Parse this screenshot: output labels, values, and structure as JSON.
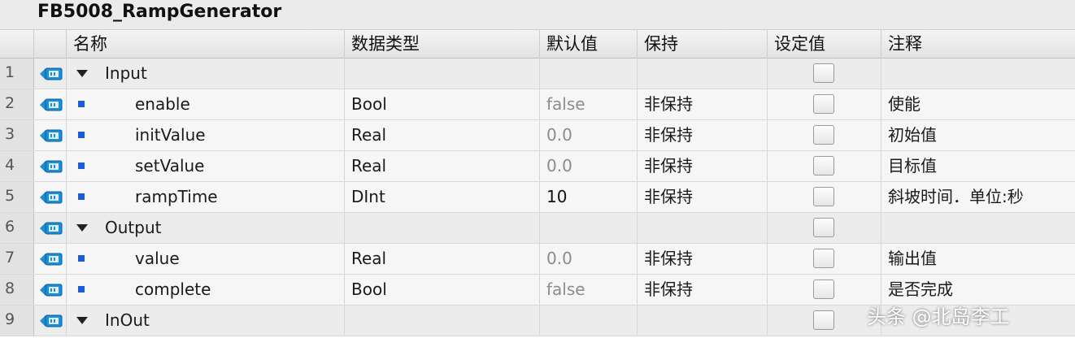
{
  "block_title": "FB5008_RampGenerator",
  "columns": {
    "name": "名称",
    "data_type": "数据类型",
    "default_value": "默认值",
    "retain": "保持",
    "setpoint": "设定值",
    "comment": "注释"
  },
  "rows": [
    {
      "num": "1",
      "kind": "section",
      "name": "Input",
      "type": "",
      "default": "",
      "retain": "",
      "setpoint": false,
      "comment": ""
    },
    {
      "num": "2",
      "kind": "member",
      "name": "enable",
      "type": "Bool",
      "default": "false",
      "retain": "非保持",
      "setpoint": false,
      "comment": "使能"
    },
    {
      "num": "3",
      "kind": "member",
      "name": "initValue",
      "type": "Real",
      "default": "0.0",
      "retain": "非保持",
      "setpoint": false,
      "comment": "初始值"
    },
    {
      "num": "4",
      "kind": "member",
      "name": "setValue",
      "type": "Real",
      "default": "0.0",
      "retain": "非保持",
      "setpoint": false,
      "comment": "目标值"
    },
    {
      "num": "5",
      "kind": "member",
      "name": "rampTime",
      "type": "DInt",
      "default": "10",
      "retain": "非保持",
      "setpoint": false,
      "comment": "斜坡时间．单位:秒"
    },
    {
      "num": "6",
      "kind": "section",
      "name": "Output",
      "type": "",
      "default": "",
      "retain": "",
      "setpoint": false,
      "comment": ""
    },
    {
      "num": "7",
      "kind": "member",
      "name": "value",
      "type": "Real",
      "default": "0.0",
      "retain": "非保持",
      "setpoint": false,
      "comment": "输出值"
    },
    {
      "num": "8",
      "kind": "member",
      "name": "complete",
      "type": "Bool",
      "default": "false",
      "retain": "非保持",
      "setpoint": false,
      "comment": "是否完成"
    },
    {
      "num": "9",
      "kind": "section",
      "name": "InOut",
      "type": "",
      "default": "",
      "retain": "",
      "setpoint": false,
      "comment": ""
    }
  ],
  "icons": {
    "interface": "interface-param-icon",
    "expand": "expand-triangle-icon",
    "member": "member-bullet-icon"
  },
  "colors": {
    "bullet": "#1e5bd6",
    "icon_blue": "#1a8fd8",
    "default_gray": "#8c8c8c"
  },
  "watermark": "头条 @北岛李工"
}
